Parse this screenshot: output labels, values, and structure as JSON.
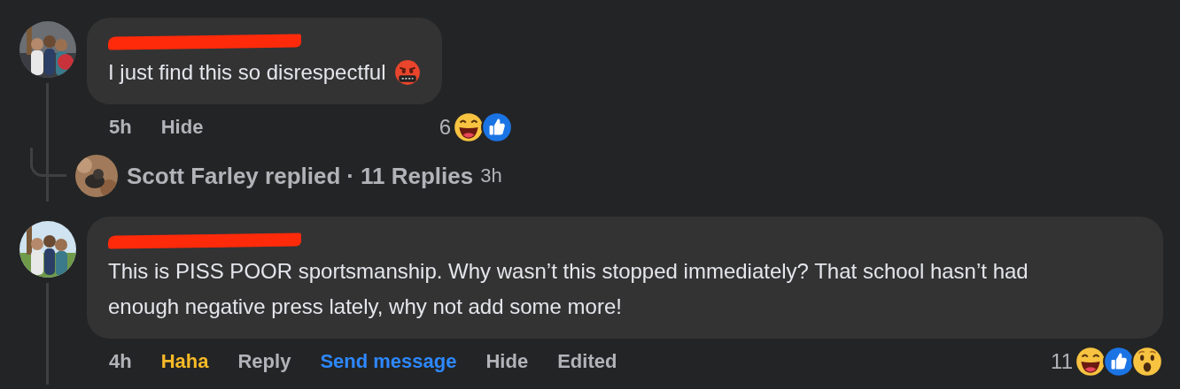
{
  "comments": [
    {
      "author_redacted": true,
      "text": "I just find this so disrespectful",
      "emoji": {
        "kind": "angry"
      },
      "actions": [
        {
          "label": "5h",
          "kind": "time"
        },
        {
          "label": "Hide",
          "kind": "plain"
        }
      ],
      "reaction_count": "6",
      "reactions": [
        {
          "kind": "haha"
        },
        {
          "kind": "like"
        }
      ],
      "reply_summary": {
        "name": "Scott Farley replied",
        "separator": "·",
        "count": "11 Replies",
        "time": "3h"
      }
    },
    {
      "author_redacted": true,
      "text": "This is PISS POOR sportsmanship. Why wasn’t this stopped immediately? That school hasn’t had enough negative press lately, why not add some more!",
      "actions": [
        {
          "label": "4h",
          "kind": "time"
        },
        {
          "label": "Haha",
          "kind": "reaction",
          "selected": true
        },
        {
          "label": "Reply",
          "kind": "plain"
        },
        {
          "label": "Send message",
          "kind": "message"
        },
        {
          "label": "Hide",
          "kind": "plain"
        },
        {
          "label": "Edited",
          "kind": "plain"
        }
      ],
      "reaction_count": "11",
      "reactions": [
        {
          "kind": "haha"
        },
        {
          "kind": "like"
        },
        {
          "kind": "wow"
        }
      ]
    }
  ]
}
